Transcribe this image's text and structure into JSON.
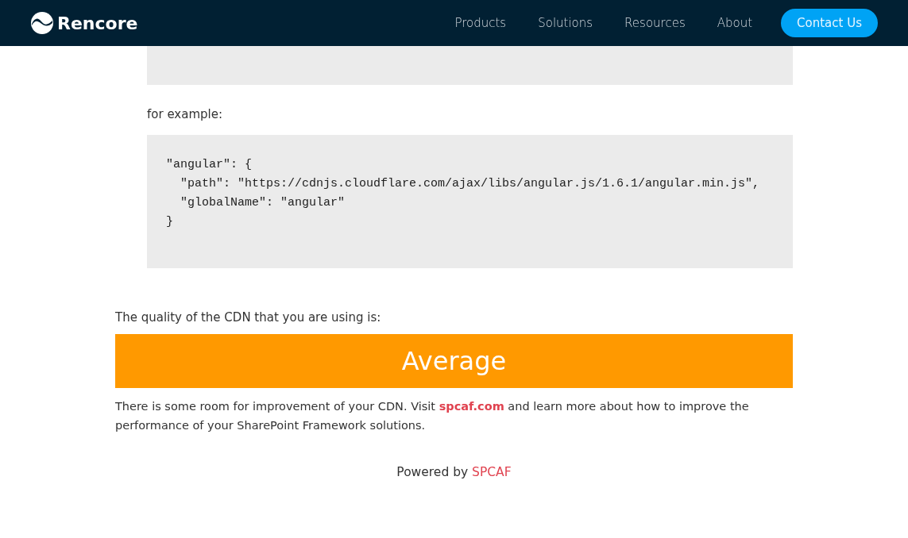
{
  "header": {
    "logo": "Rencore",
    "nav": [
      {
        "label": "Products"
      },
      {
        "label": "Solutions"
      },
      {
        "label": "Resources"
      },
      {
        "label": "About"
      }
    ],
    "cta": "Contact Us"
  },
  "example_label": "for example:",
  "code_lines": [
    "\"angular\": {",
    "  \"path\": \"https://cdnjs.cloudflare.com/ajax/libs/angular.js/1.6.1/angular.min.js\",",
    "  \"globalName\": \"angular\"",
    "}"
  ],
  "quality_label": "The quality of the CDN that you are using is:",
  "quality": {
    "rating": "Average",
    "color": "#ff9900"
  },
  "advice": {
    "before": "There is some room for improvement of your CDN. Visit ",
    "link": "spcaf.com",
    "after": " and learn more about how to improve the performance of your SharePoint Framework solutions."
  },
  "footer": {
    "text": "Powered by ",
    "link": "SPCAF"
  }
}
